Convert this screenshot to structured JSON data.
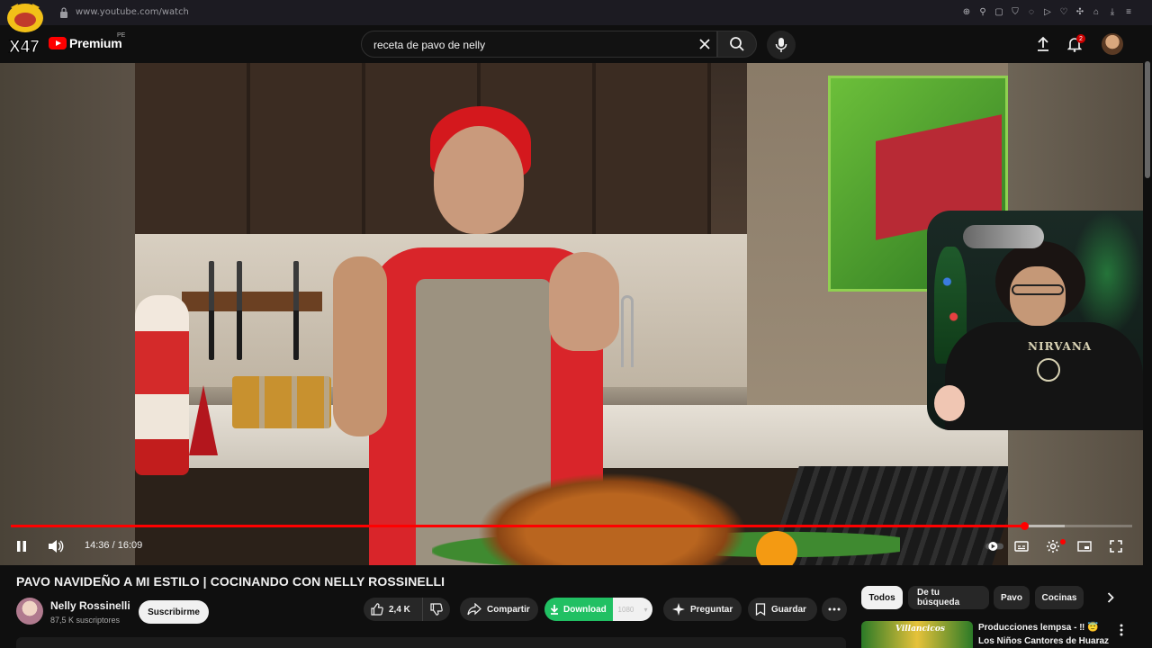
{
  "browser": {
    "url": "www.youtube.com/watch",
    "icons": [
      "zoom-icon",
      "pin-icon",
      "bookmark-icon",
      "shield-icon",
      "extension-icon",
      "play-icon",
      "heart-icon",
      "puzzle-icon",
      "account-icon",
      "download-icon",
      "menu-icon"
    ]
  },
  "header": {
    "channel_logo_text": "X47",
    "brand": "Premium",
    "region": "PE",
    "search_query": "receta de pavo de  nelly",
    "notification_count": "2"
  },
  "player": {
    "time_current": "14:36",
    "time_separator": " / ",
    "time_total": "16:09",
    "progress_played_fraction": 0.904,
    "progress_loaded_fraction": 0.94,
    "accent_color": "#ff0000"
  },
  "facecam": {
    "shirt_text": "NIRVANA"
  },
  "video": {
    "title": "PAVO NAVIDEÑO A MI ESTILO | COCINANDO CON NELLY ROSSINELLI",
    "channel_name": "Nelly Rossinelli",
    "subscribers": "87,5 K suscriptores",
    "subscribe_label": "Suscribirme"
  },
  "actions": {
    "likes": "2,4 K",
    "share": "Compartir",
    "download": "Download",
    "download_quality": "1080",
    "ask": "Preguntar",
    "save": "Guardar"
  },
  "chips": [
    "Todos",
    "De tu búsqueda",
    "Pavo",
    "Cocinas"
  ],
  "recommendation": {
    "thumb_text": "Villancicos",
    "title_line1": "Producciones lempsa - ‼ 😇",
    "title_line2": "Los Niños Cantores de Huaraz"
  }
}
